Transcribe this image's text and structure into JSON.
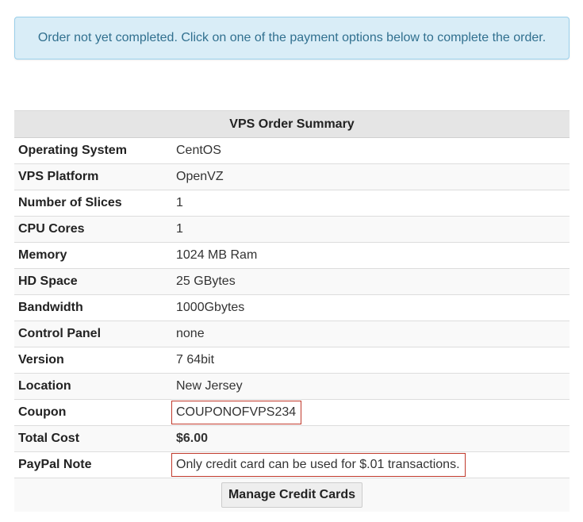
{
  "alert": {
    "message": "Order not yet completed. Click on one of the payment options below to complete the order."
  },
  "summary": {
    "title": "VPS Order Summary",
    "rows": [
      {
        "label": "Operating System",
        "value": "CentOS"
      },
      {
        "label": "VPS Platform",
        "value": "OpenVZ"
      },
      {
        "label": "Number of Slices",
        "value": "1"
      },
      {
        "label": "CPU Cores",
        "value": "1"
      },
      {
        "label": "Memory",
        "value": "1024 MB Ram"
      },
      {
        "label": "HD Space",
        "value": "25 GBytes"
      },
      {
        "label": "Bandwidth",
        "value": "1000Gbytes"
      },
      {
        "label": "Control Panel",
        "value": "none"
      },
      {
        "label": "Version",
        "value": "7 64bit"
      },
      {
        "label": "Location",
        "value": "New Jersey"
      },
      {
        "label": "Coupon",
        "value": "COUPONOFVPS234"
      },
      {
        "label": "Total Cost",
        "value": "$6.00"
      },
      {
        "label": "PayPal Note",
        "value": "Only credit card can be used for $.01 transactions."
      }
    ],
    "manage_button": "Manage Credit Cards"
  },
  "colors": {
    "alert_bg": "#d9edf7",
    "alert_text": "#31708f",
    "highlight_box": "#c0392b"
  }
}
